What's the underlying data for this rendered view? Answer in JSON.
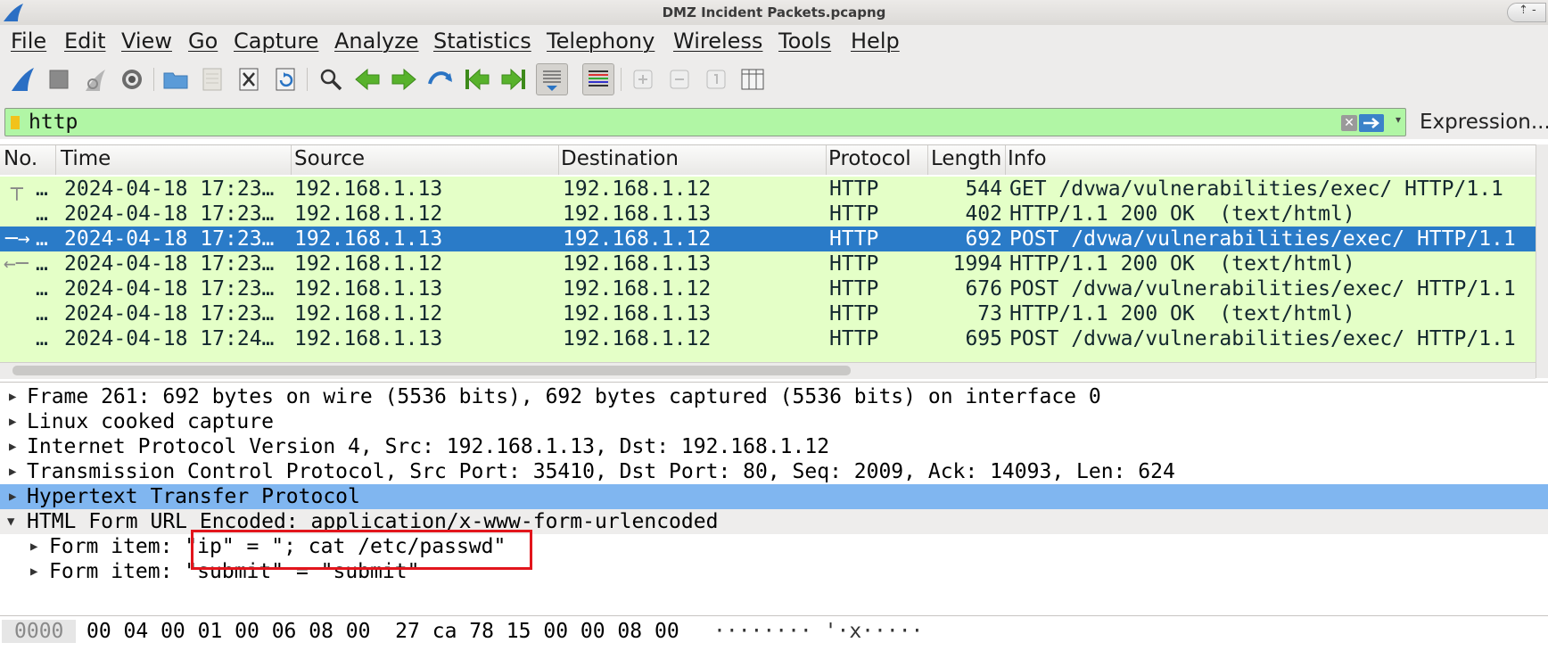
{
  "window": {
    "title": "DMZ Incident Packets.pcapng"
  },
  "menu": [
    "File",
    "Edit",
    "View",
    "Go",
    "Capture",
    "Analyze",
    "Statistics",
    "Telephony",
    "Wireless",
    "Tools",
    "Help"
  ],
  "toolbar_icons": [
    "shark-fin-start-icon",
    "stop-icon",
    "restart-icon",
    "options-gear-icon",
    "open-folder-icon",
    "save-icon",
    "close-file-icon",
    "reload-icon",
    "find-icon",
    "go-back-icon",
    "go-forward-icon",
    "go-to-packet-icon",
    "first-packet-icon",
    "last-packet-icon",
    "autoscroll-icon",
    "colorize-icon",
    "zoom-in-icon",
    "zoom-out-icon",
    "normal-size-icon",
    "resize-columns-icon"
  ],
  "filter": {
    "value": "http",
    "expression_label": "Expression..."
  },
  "packet_list": {
    "columns": [
      "No.",
      "Time",
      "Source",
      "Destination",
      "Protocol",
      "Length",
      "Info"
    ],
    "rows": [
      {
        "no": "…",
        "time": "2024-04-18 17:23…",
        "src": "192.168.1.13",
        "dst": "192.168.1.12",
        "proto": "HTTP",
        "len": "544",
        "info": "GET /dvwa/vulnerabilities/exec/ HTTP/1.1"
      },
      {
        "no": "…",
        "time": "2024-04-18 17:23…",
        "src": "192.168.1.12",
        "dst": "192.168.1.13",
        "proto": "HTTP",
        "len": "402",
        "info": "HTTP/1.1 200 OK  (text/html)"
      },
      {
        "no": "…",
        "time": "2024-04-18 17:23…",
        "src": "192.168.1.13",
        "dst": "192.168.1.12",
        "proto": "HTTP",
        "len": "692",
        "info": "POST /dvwa/vulnerabilities/exec/ HTTP/1.1"
      },
      {
        "no": "…",
        "time": "2024-04-18 17:23…",
        "src": "192.168.1.12",
        "dst": "192.168.1.13",
        "proto": "HTTP",
        "len": "1994",
        "info": "HTTP/1.1 200 OK  (text/html)"
      },
      {
        "no": "…",
        "time": "2024-04-18 17:23…",
        "src": "192.168.1.13",
        "dst": "192.168.1.12",
        "proto": "HTTP",
        "len": "676",
        "info": "POST /dvwa/vulnerabilities/exec/ HTTP/1.1"
      },
      {
        "no": "…",
        "time": "2024-04-18 17:23…",
        "src": "192.168.1.12",
        "dst": "192.168.1.13",
        "proto": "HTTP",
        "len": "73",
        "info": "HTTP/1.1 200 OK  (text/html)"
      },
      {
        "no": "…",
        "time": "2024-04-18 17:24…",
        "src": "192.168.1.13",
        "dst": "192.168.1.12",
        "proto": "HTTP",
        "len": "695",
        "info": "POST /dvwa/vulnerabilities/exec/ HTTP/1.1"
      }
    ],
    "selected_index": 2
  },
  "details": [
    {
      "text": "Frame 261: 692 bytes on wire (5536 bits), 692 bytes captured (5536 bits) on interface 0",
      "expanded": false
    },
    {
      "text": "Linux cooked capture",
      "expanded": false
    },
    {
      "text": "Internet Protocol Version 4, Src: 192.168.1.13, Dst: 192.168.1.12",
      "expanded": false
    },
    {
      "text": "Transmission Control Protocol, Src Port: 35410, Dst Port: 80, Seq: 2009, Ack: 14093, Len: 624",
      "expanded": false
    },
    {
      "text": "Hypertext Transfer Protocol",
      "expanded": false
    },
    {
      "text": "HTML Form URL Encoded: application/x-www-form-urlencoded",
      "expanded": true
    },
    {
      "text": "Form item: \"ip\" = \"; cat /etc/passwd\"",
      "expanded": false
    },
    {
      "text": "Form item: \"submit\" = \"submit\"",
      "expanded": false
    }
  ],
  "bytes": {
    "offset": "0000",
    "hex": "00 04 00 01 00 06 08 00  27 ca 78 15 00 00 08 00",
    "ascii": "········ '·x·····"
  },
  "colors": {
    "http_row": "#e4ffc7",
    "selected_row": "#2a7bc8",
    "detail_highlight": "#80b6f0",
    "filter_valid": "#b1f6a5",
    "annotation_box": "#e2151c"
  }
}
